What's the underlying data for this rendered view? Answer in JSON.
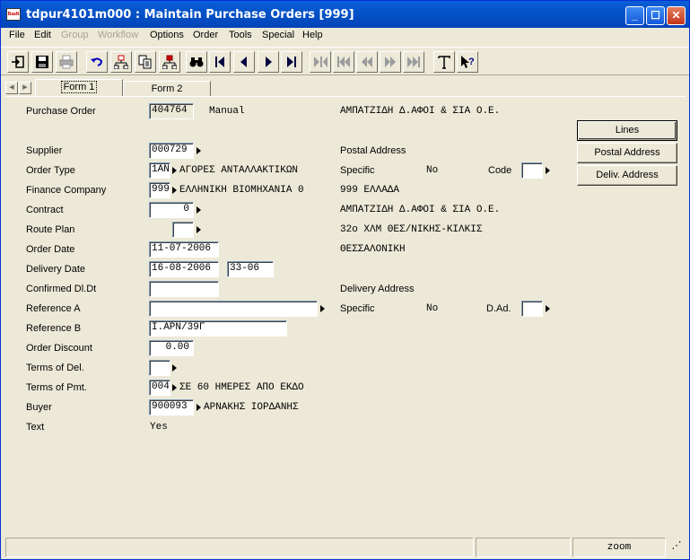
{
  "window": {
    "title": "tdpur4101m000 : Maintain Purchase Orders [999]",
    "app_icon": "baan-app-icon",
    "controls": [
      "minimize-icon",
      "maximize-icon",
      "close-icon"
    ]
  },
  "menubar": {
    "items": [
      {
        "label": "File",
        "enabled": true
      },
      {
        "label": "Edit",
        "enabled": true
      },
      {
        "label": "Group",
        "enabled": false
      },
      {
        "label": "Workflow",
        "enabled": false
      },
      {
        "label": "Options",
        "enabled": true
      },
      {
        "label": "Order",
        "enabled": true
      },
      {
        "label": "Tools",
        "enabled": true
      },
      {
        "label": "Special",
        "enabled": true
      },
      {
        "label": "Help",
        "enabled": true
      }
    ]
  },
  "toolbar": {
    "buttons": [
      "exit-icon",
      "save-icon",
      "print-icon",
      "undo-icon",
      "insert-record-icon",
      "copy-record-icon",
      "delete-record-icon",
      "find-icon",
      "first-record-icon",
      "previous-record-icon",
      "next-record-icon",
      "last-record-icon",
      "first-set-icon",
      "previous-set-icon",
      "previous-group-icon",
      "next-group-icon",
      "last-set-icon",
      "text-icon",
      "whats-this-icon"
    ]
  },
  "tabs": [
    {
      "label": "Form 1",
      "active": true
    },
    {
      "label": "Form 2",
      "active": false
    }
  ],
  "form": {
    "purchase_order": {
      "label": "Purchase Order",
      "value": "404764",
      "mode": "Manual"
    },
    "supplier_name": "ΑΜΠΑΤΖΙΔΗ Δ.ΑΦΟΙ & ΣΙΑ Ο.Ε.",
    "supplier": {
      "label": "Supplier",
      "value": "000729"
    },
    "order_type": {
      "label": "Order Type",
      "code": "1AN",
      "description": "ΑΓΟΡΕΣ ΑΝΤΑΛΛΑΚΤΙΚΩΝ"
    },
    "finance_company": {
      "label": "Finance Company",
      "code": "999",
      "description": "ΕΛΛΗΝΙΚΗ ΒΙΟΜΗΧΑΝΙΑ 0"
    },
    "contract": {
      "label": "Contract",
      "value": "0"
    },
    "route_plan": {
      "label": "Route Plan",
      "value": ""
    },
    "order_date": {
      "label": "Order Date",
      "value": "11-07-2006"
    },
    "delivery_date": {
      "label": "Delivery Date",
      "value": "16-08-2006",
      "week": "33-06"
    },
    "confirmed_dl_dt": {
      "label": "Confirmed Dl.Dt",
      "value": ""
    },
    "reference_a": {
      "label": "Reference A",
      "value": ""
    },
    "reference_b": {
      "label": "Reference B",
      "value": "Ι.ΑΡΝ/39Γ"
    },
    "order_discount": {
      "label": "Order Discount",
      "value": "0.00"
    },
    "terms_of_del": {
      "label": "Terms of Del.",
      "value": ""
    },
    "terms_of_pmt": {
      "label": "Terms of Pmt.",
      "code": "004",
      "description": "ΣΕ 60 ΗΜΕΡΕΣ ΑΠΟ ΕΚΔΟ"
    },
    "buyer": {
      "label": "Buyer",
      "code": "900093",
      "description": "ΑΡΝΑΚΗΣ ΙΟΡΔΑΝΗΣ"
    },
    "text": {
      "label": "Text",
      "value": "Yes"
    },
    "postal_address": {
      "heading": "Postal Address",
      "specific_label": "Specific",
      "specific_value": "No",
      "code_label": "Code",
      "code_value": "",
      "line1": "999  ΕΛΛΑΔΑ",
      "line2": "ΑΜΠΑΤΖΙΔΗ Δ.ΑΦΟΙ & ΣΙΑ Ο.Ε.",
      "line3": "32ο ΧΛΜ ΘΕΣ/ΝΙΚΗΣ-ΚΙΛΚΙΣ",
      "line4": "ΘΕΣΣΑΛΟΝΙΚΗ"
    },
    "delivery_address": {
      "heading": "Delivery Address",
      "specific_label": "Specific",
      "specific_value": "No",
      "dad_label": "D.Ad.",
      "dad_value": ""
    }
  },
  "side_buttons": {
    "lines": "Lines",
    "postal_address": "Postal Address",
    "deliv_address": "Deliv. Address"
  },
  "statusbar": {
    "zoom": "zoom"
  }
}
